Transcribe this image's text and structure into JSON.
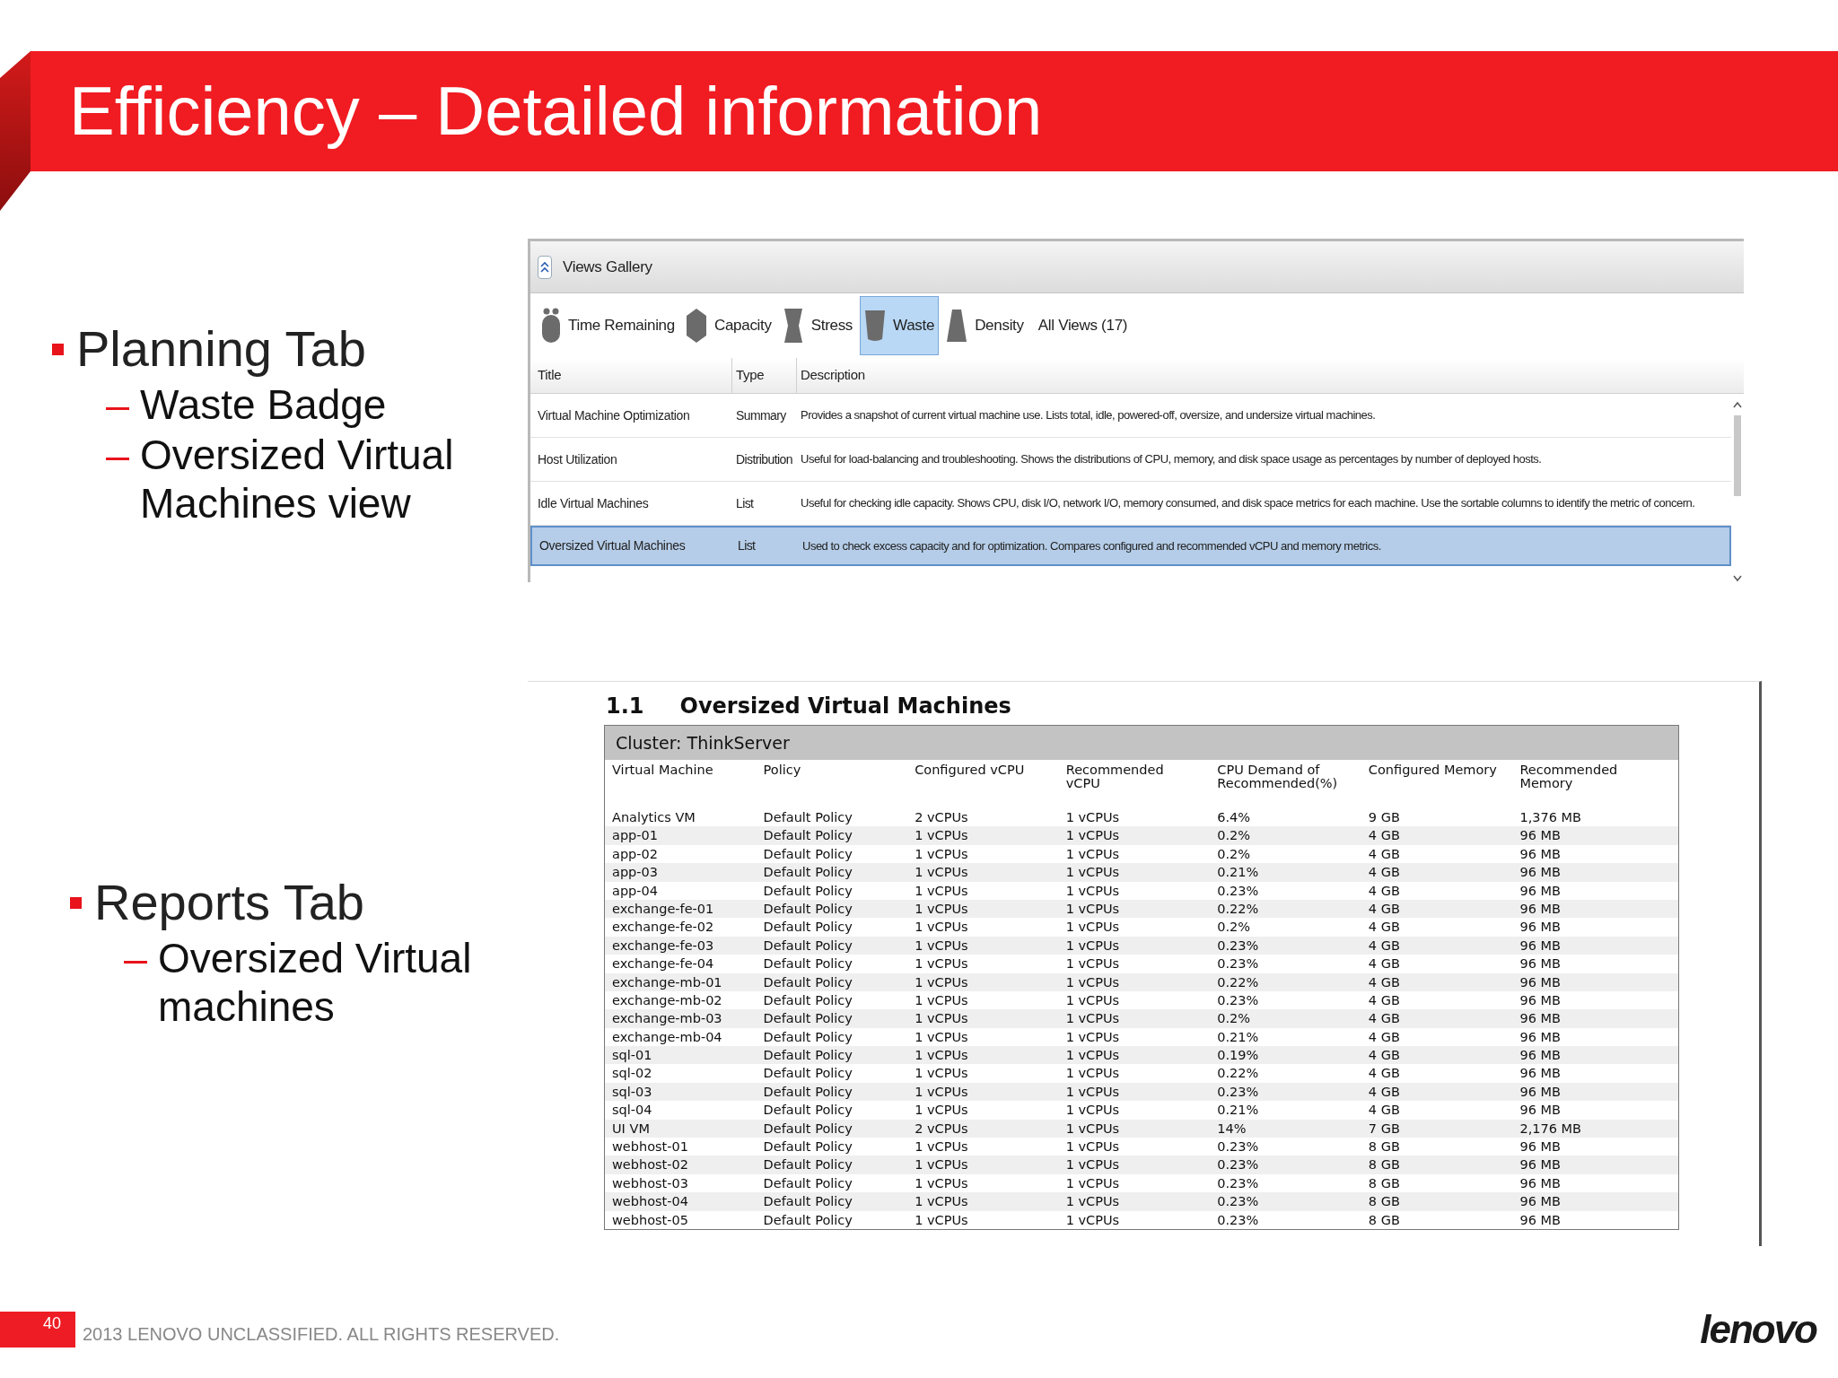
{
  "slide_title": "Efficiency – Detailed information",
  "bullet_groups": [
    {
      "text": "Planning Tab",
      "children": [
        {
          "text": "Waste Badge"
        },
        {
          "text": "Oversized Virtual Machines view"
        }
      ]
    },
    {
      "text": "Reports Tab",
      "children": [
        {
          "text": "Oversized Virtual machines"
        }
      ]
    }
  ],
  "views_gallery": {
    "title": "Views Gallery",
    "badges": [
      {
        "label": "Time Remaining",
        "kind": "timer",
        "selected": false
      },
      {
        "label": "Capacity",
        "kind": "hexagon",
        "selected": false
      },
      {
        "label": "Stress",
        "kind": "stress",
        "selected": false
      },
      {
        "label": "Waste",
        "kind": "bin",
        "selected": true
      },
      {
        "label": "Density",
        "kind": "trapezoid",
        "selected": false
      }
    ],
    "all_views": "All Views (17)",
    "columns": [
      "Title",
      "Type",
      "Description"
    ],
    "rows": [
      {
        "title": "Virtual Machine Optimization",
        "type": "Summary",
        "description": "Provides a snapshot of current virtual machine use. Lists total, idle, powered-off, oversize, and undersize virtual machines.",
        "selected": false
      },
      {
        "title": "Host Utilization",
        "type": "Distribution",
        "description": "Useful for load-balancing and troubleshooting. Shows the distributions of CPU, memory, and disk space usage as percentages by number of deployed hosts.",
        "selected": false
      },
      {
        "title": "Idle Virtual Machines",
        "type": "List",
        "description": "Useful for checking idle capacity. Shows CPU, disk I/O, network I/O, memory consumed, and disk space metrics for each machine. Use the sortable columns to identify the metric of concern.",
        "selected": false
      },
      {
        "title": "Oversized Virtual Machines",
        "type": "List",
        "description": "Used to check excess capacity and for optimization. Compares configured and recommended vCPU and memory metrics.",
        "selected": true
      }
    ]
  },
  "report": {
    "number": "1.1",
    "title": "Oversized Virtual Machines",
    "cluster": "Cluster: ThinkServer",
    "columns": [
      "Virtual Machine",
      "Policy",
      "Configured vCPU",
      "Recommended vCPU",
      "CPU Demand of Recommended(%)",
      "Configured Memory",
      "Recommended Memory"
    ],
    "rows": [
      [
        "Analytics VM",
        "Default Policy",
        "2 vCPUs",
        "1 vCPUs",
        "6.4%",
        "9 GB",
        "1,376 MB"
      ],
      [
        "app-01",
        "Default Policy",
        "1 vCPUs",
        "1 vCPUs",
        "0.2%",
        "4 GB",
        "96 MB"
      ],
      [
        "app-02",
        "Default Policy",
        "1 vCPUs",
        "1 vCPUs",
        "0.2%",
        "4 GB",
        "96 MB"
      ],
      [
        "app-03",
        "Default Policy",
        "1 vCPUs",
        "1 vCPUs",
        "0.21%",
        "4 GB",
        "96 MB"
      ],
      [
        "app-04",
        "Default Policy",
        "1 vCPUs",
        "1 vCPUs",
        "0.23%",
        "4 GB",
        "96 MB"
      ],
      [
        "exchange-fe-01",
        "Default Policy",
        "1 vCPUs",
        "1 vCPUs",
        "0.22%",
        "4 GB",
        "96 MB"
      ],
      [
        "exchange-fe-02",
        "Default Policy",
        "1 vCPUs",
        "1 vCPUs",
        "0.2%",
        "4 GB",
        "96 MB"
      ],
      [
        "exchange-fe-03",
        "Default Policy",
        "1 vCPUs",
        "1 vCPUs",
        "0.23%",
        "4 GB",
        "96 MB"
      ],
      [
        "exchange-fe-04",
        "Default Policy",
        "1 vCPUs",
        "1 vCPUs",
        "0.23%",
        "4 GB",
        "96 MB"
      ],
      [
        "exchange-mb-01",
        "Default Policy",
        "1 vCPUs",
        "1 vCPUs",
        "0.22%",
        "4 GB",
        "96 MB"
      ],
      [
        "exchange-mb-02",
        "Default Policy",
        "1 vCPUs",
        "1 vCPUs",
        "0.23%",
        "4 GB",
        "96 MB"
      ],
      [
        "exchange-mb-03",
        "Default Policy",
        "1 vCPUs",
        "1 vCPUs",
        "0.2%",
        "4 GB",
        "96 MB"
      ],
      [
        "exchange-mb-04",
        "Default Policy",
        "1 vCPUs",
        "1 vCPUs",
        "0.21%",
        "4 GB",
        "96 MB"
      ],
      [
        "sql-01",
        "Default Policy",
        "1 vCPUs",
        "1 vCPUs",
        "0.19%",
        "4 GB",
        "96 MB"
      ],
      [
        "sql-02",
        "Default Policy",
        "1 vCPUs",
        "1 vCPUs",
        "0.22%",
        "4 GB",
        "96 MB"
      ],
      [
        "sql-03",
        "Default Policy",
        "1 vCPUs",
        "1 vCPUs",
        "0.23%",
        "4 GB",
        "96 MB"
      ],
      [
        "sql-04",
        "Default Policy",
        "1 vCPUs",
        "1 vCPUs",
        "0.21%",
        "4 GB",
        "96 MB"
      ],
      [
        "UI VM",
        "Default Policy",
        "2 vCPUs",
        "1 vCPUs",
        "14%",
        "7 GB",
        "2,176 MB"
      ],
      [
        "webhost-01",
        "Default Policy",
        "1 vCPUs",
        "1 vCPUs",
        "0.23%",
        "8 GB",
        "96 MB"
      ],
      [
        "webhost-02",
        "Default Policy",
        "1 vCPUs",
        "1 vCPUs",
        "0.23%",
        "8 GB",
        "96 MB"
      ],
      [
        "webhost-03",
        "Default Policy",
        "1 vCPUs",
        "1 vCPUs",
        "0.23%",
        "8 GB",
        "96 MB"
      ],
      [
        "webhost-04",
        "Default Policy",
        "1 vCPUs",
        "1 vCPUs",
        "0.23%",
        "8 GB",
        "96 MB"
      ],
      [
        "webhost-05",
        "Default Policy",
        "1 vCPUs",
        "1 vCPUs",
        "0.23%",
        "8 GB",
        "96 MB"
      ]
    ]
  },
  "footer": {
    "page_number": "40",
    "notice": "2013 LENOVO UNCLASSIFIED. ALL RIGHTS RESERVED.",
    "logo": "lenovo"
  }
}
